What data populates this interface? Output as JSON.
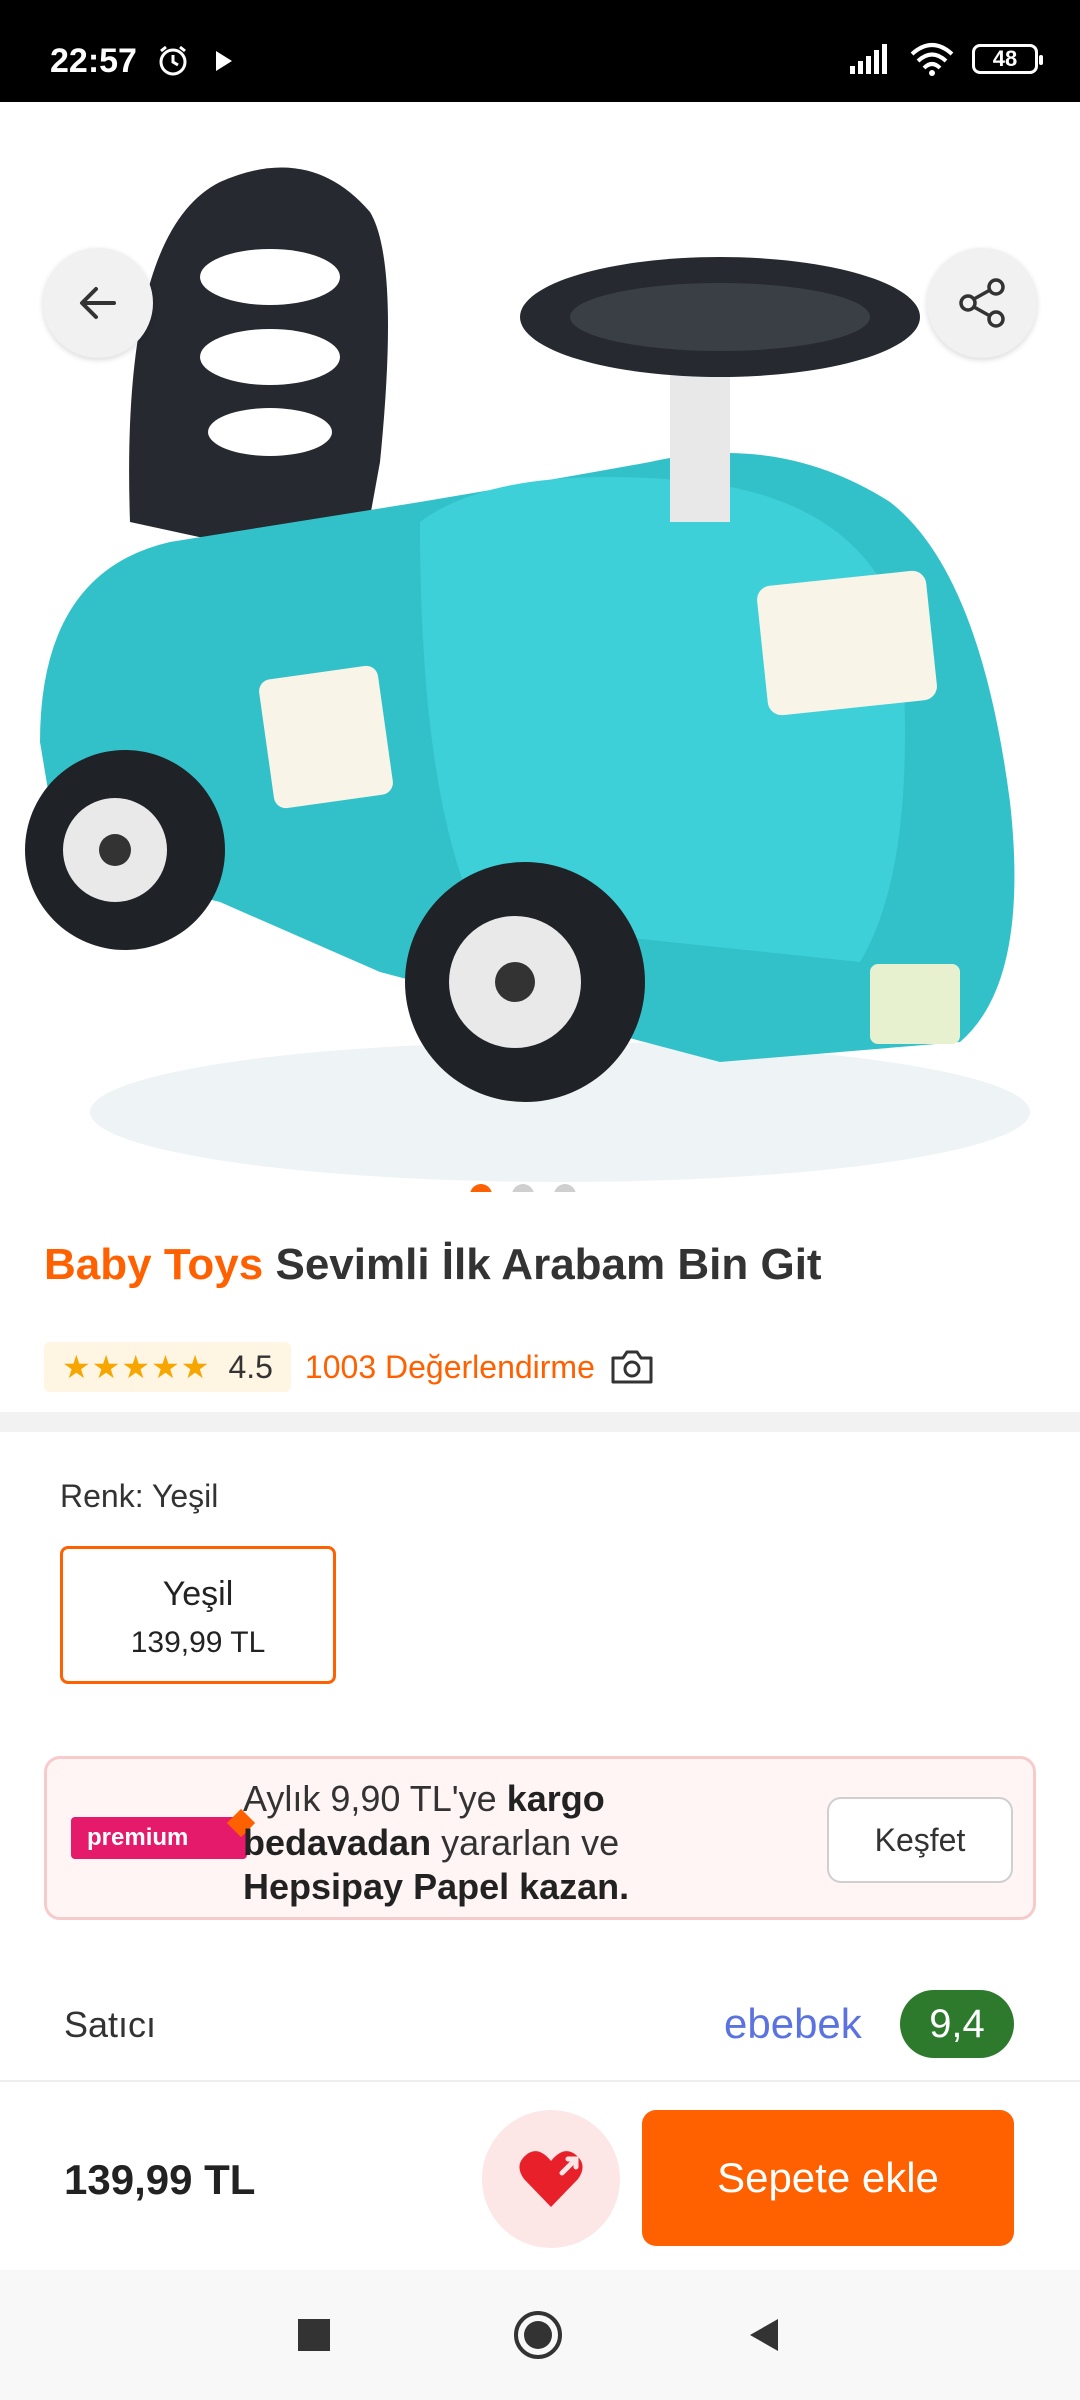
{
  "status_bar": {
    "time": "22:57",
    "battery": "48"
  },
  "product": {
    "brand": "Baby Toys",
    "name": "Sevimli İlk Arabam Bin Git",
    "rating": "4.5",
    "rating_stars": 4.5,
    "review_count": "1003 Değerlendirme",
    "image_index": 1,
    "image_count": 3
  },
  "variant": {
    "label": "Renk: Yeşil",
    "option_name": "Yeşil",
    "option_price": "139,99 TL"
  },
  "premium": {
    "badge": "premium",
    "text_1": "Aylık 9,90 TL'ye ",
    "text_1_bold": "kargo",
    "text_2_bold": "bedavadan",
    "text_2": " yararlan ve",
    "text_3_bold": "Hepsipay Papel kazan.",
    "button": "Keşfet"
  },
  "seller": {
    "label": "Satıcı",
    "name": "ebebek",
    "score": "9,4"
  },
  "bottom": {
    "price": "139,99 TL",
    "cart_button": "Sepete ekle"
  },
  "colors": {
    "accent": "#ff6000",
    "seller_score_bg": "#2d7a2d",
    "seller_name": "#5a73e0"
  }
}
